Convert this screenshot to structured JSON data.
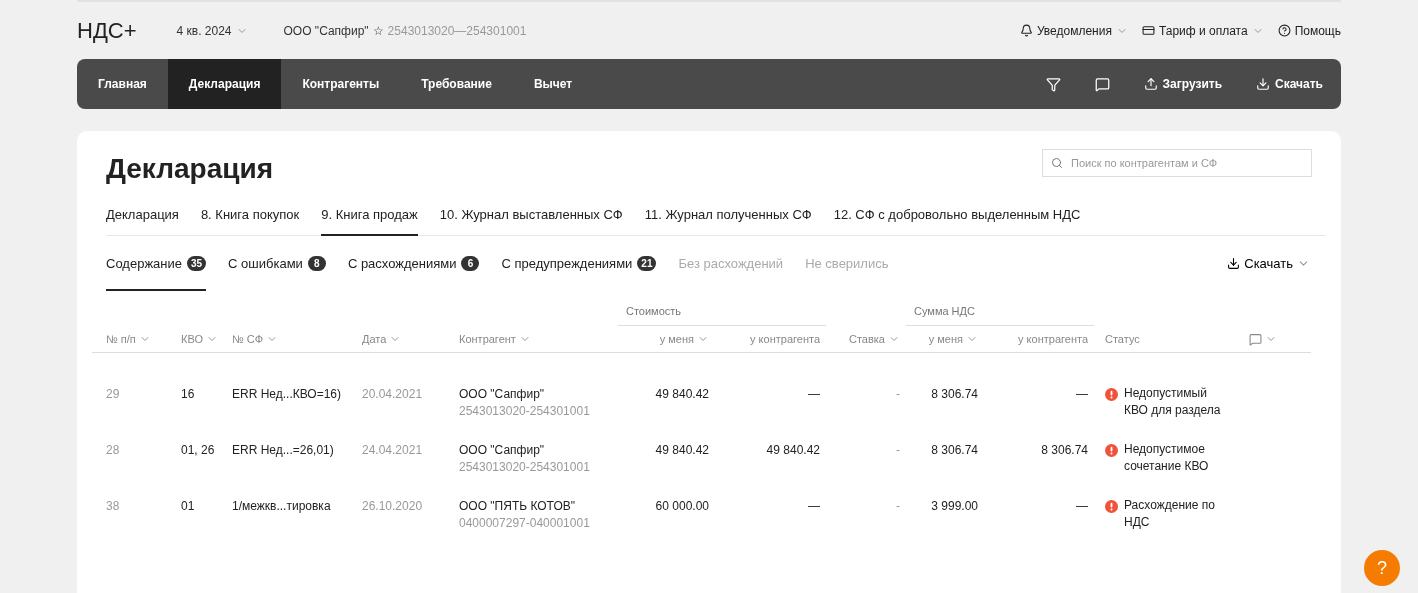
{
  "header": {
    "logo": "НДС+",
    "period": "4 кв. 2024",
    "company": "ООО \"Сапфир\"",
    "company_star": "☆",
    "company_ids": "2543013020—254301001",
    "links": [
      {
        "kind": "bell",
        "label": "Уведомления",
        "dropdown": true
      },
      {
        "kind": "card",
        "label": "Тариф и оплата",
        "dropdown": true
      },
      {
        "kind": "help",
        "label": "Помощь",
        "dropdown": false
      }
    ]
  },
  "nav": {
    "items": [
      {
        "label": "Главная",
        "selected": false
      },
      {
        "label": "Декларация",
        "selected": true
      },
      {
        "label": "Контрагенты",
        "selected": false
      },
      {
        "label": "Требование",
        "selected": false
      },
      {
        "label": "Вычет",
        "selected": false
      }
    ],
    "actions": [
      {
        "kind": "filter"
      },
      {
        "kind": "comment"
      },
      {
        "kind": "upload",
        "label": "Загрузить"
      },
      {
        "kind": "download",
        "label": "Скачать"
      }
    ]
  },
  "page": {
    "title": "Декларация",
    "search": {
      "placeholder": "Поиск по контрагентам и СФ"
    },
    "tabs": [
      {
        "label": "Декларация",
        "selected": false
      },
      {
        "label": "8. Книга покупок",
        "selected": false
      },
      {
        "label": "9. Книга продаж",
        "selected": true
      },
      {
        "label": "10. Журнал выставленных СФ",
        "selected": false
      },
      {
        "label": "11. Журнал полученных СФ",
        "selected": false
      },
      {
        "label": "12. СФ с добровольно выделенным НДС",
        "selected": false
      }
    ],
    "subtabs": [
      {
        "label": "Содержание",
        "count": "35",
        "selected": true,
        "disabled": false
      },
      {
        "label": "С ошибками",
        "count": "8",
        "selected": false,
        "disabled": false
      },
      {
        "label": "С расхождениями",
        "count": "6",
        "selected": false,
        "disabled": false
      },
      {
        "label": "С предупреждениями",
        "count": "21",
        "selected": false,
        "disabled": false
      },
      {
        "label": "Без расхождений",
        "selected": false,
        "disabled": true
      },
      {
        "label": "Не сверились",
        "selected": false,
        "disabled": true
      }
    ],
    "download": "Скачать"
  },
  "table": {
    "groups": [
      {
        "label": "Стоимость"
      },
      {
        "label": "Сумма НДС"
      }
    ],
    "columns": [
      {
        "kind": "text",
        "label": "№ п/п",
        "sortable": true
      },
      {
        "kind": "text",
        "label": "КВО",
        "sortable": true
      },
      {
        "kind": "text",
        "label": "№ СФ",
        "sortable": true
      },
      {
        "kind": "text",
        "label": "Дата",
        "sortable": true
      },
      {
        "kind": "text",
        "label": "Контрагент",
        "sortable": true
      },
      {
        "kind": "text",
        "label": "у меня",
        "sortable": true
      },
      {
        "kind": "text",
        "label": "у контрагента",
        "sortable": false
      },
      {
        "kind": "text",
        "label": "Ставка",
        "sortable": true
      },
      {
        "kind": "text",
        "label": "у меня",
        "sortable": true
      },
      {
        "kind": "text",
        "label": "у контрагента",
        "sortable": false
      },
      {
        "kind": "text",
        "label": "Статус",
        "sortable": false
      },
      {
        "kind": "comment",
        "sortable": true
      }
    ],
    "rows": [
      {
        "n": "29",
        "kvo": "16",
        "sf": "ERR Нед...КВО=16)",
        "date": "20.04.2021",
        "contractor": "ООО \"Сапфир\"",
        "inn": "2543013020-254301001",
        "cost_mine": "49 840.42",
        "cost_theirs": "—",
        "rate": "-",
        "vat_mine": "8 306.74",
        "vat_theirs": "—",
        "status": {
          "kind": "error",
          "text": "Недопустимый КВО для раздела"
        }
      },
      {
        "n": "28",
        "kvo": "01, 26",
        "sf": "ERR Нед...=26,01)",
        "date": "24.04.2021",
        "contractor": "ООО \"Сапфир\"",
        "inn": "2543013020-254301001",
        "cost_mine": "49 840.42",
        "cost_theirs": "49 840.42",
        "rate": "-",
        "vat_mine": "8 306.74",
        "vat_theirs": "8 306.74",
        "status": {
          "kind": "error",
          "text": "Недопустимое сочетание КВО"
        }
      },
      {
        "n": "38",
        "kvo": "01",
        "sf": "1/межкв...тировка",
        "date": "26.10.2020",
        "contractor": "ООО \"ПЯТЬ КОТОВ\"",
        "inn": "0400007297-040001001",
        "cost_mine": "60 000.00",
        "cost_theirs": "—",
        "rate": "-",
        "vat_mine": "3 999.00",
        "vat_theirs": "—",
        "status": {
          "kind": "error",
          "text": "Расхождение по НДС"
        }
      }
    ]
  },
  "help_button": "?"
}
